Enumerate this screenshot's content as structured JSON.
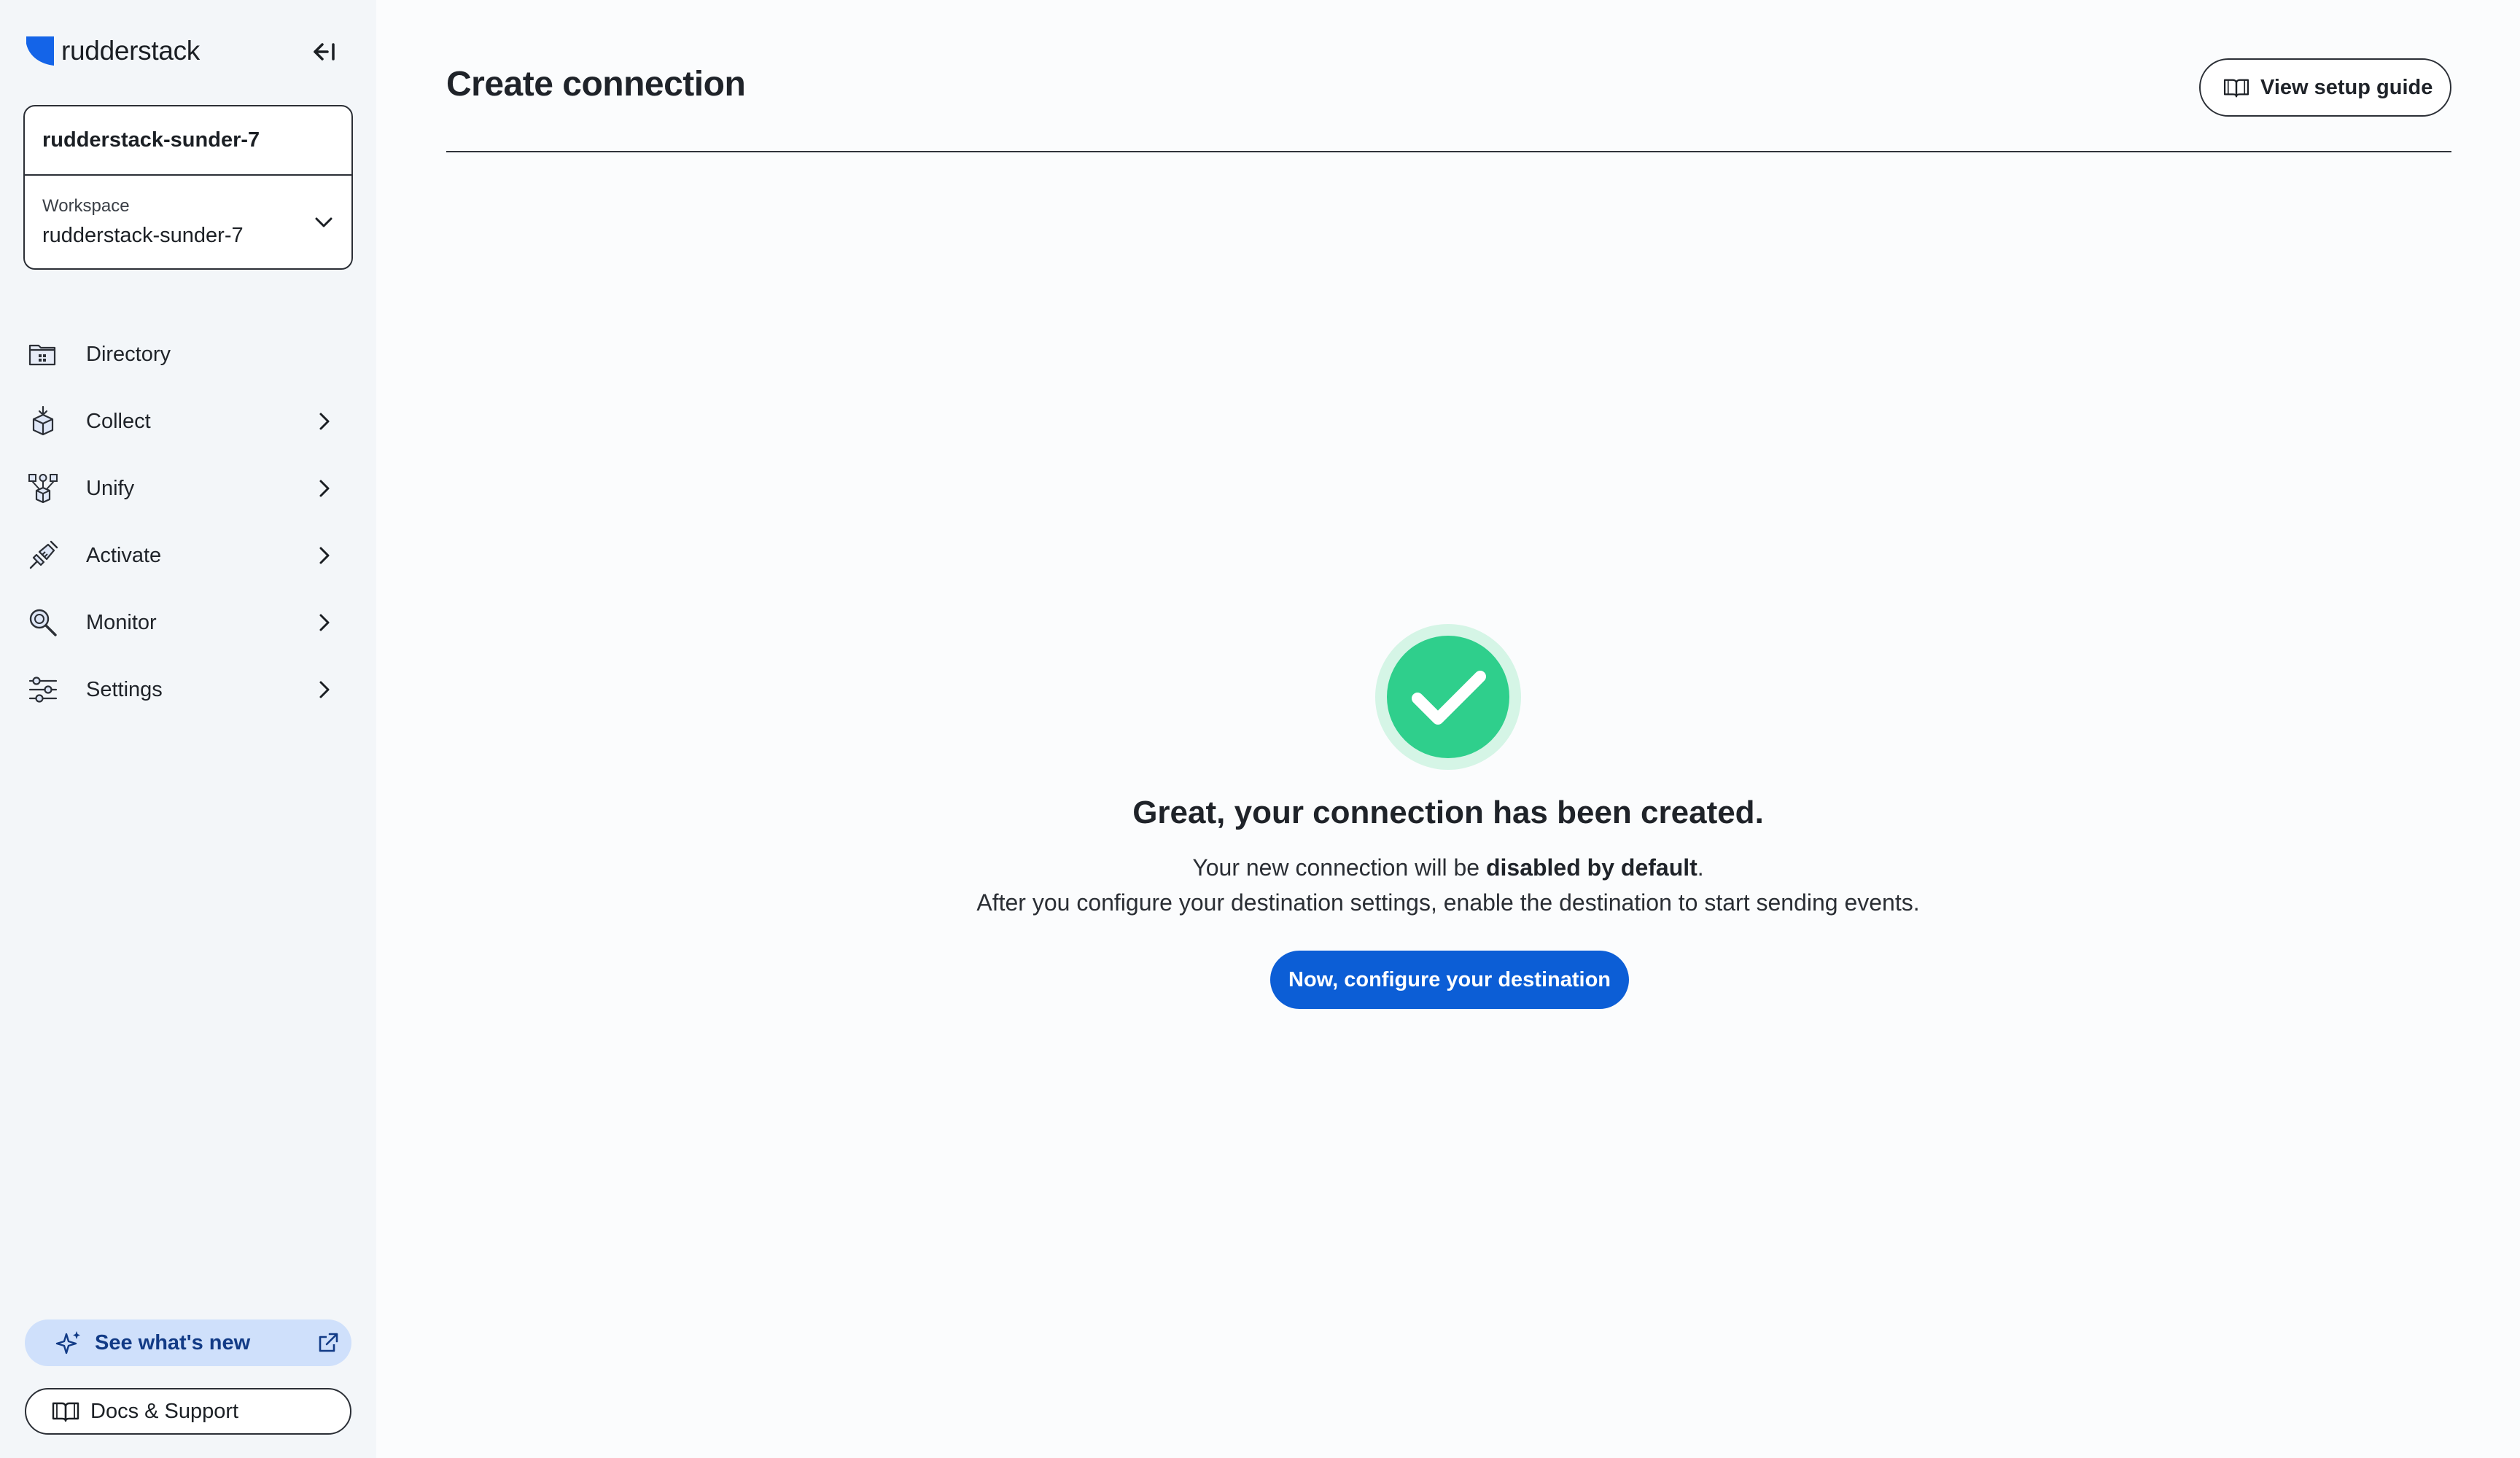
{
  "brand": {
    "name": "rudderstack"
  },
  "workspace": {
    "organization": "rudderstack-sunder-7",
    "label": "Workspace",
    "value": "rudderstack-sunder-7"
  },
  "nav": {
    "items": [
      {
        "label": "Directory",
        "icon": "directory-icon"
      },
      {
        "label": "Collect",
        "icon": "collect-icon"
      },
      {
        "label": "Unify",
        "icon": "unify-icon"
      },
      {
        "label": "Activate",
        "icon": "activate-icon"
      },
      {
        "label": "Monitor",
        "icon": "monitor-icon"
      },
      {
        "label": "Settings",
        "icon": "settings-icon"
      }
    ]
  },
  "sidebar_footer": {
    "whats_new_label": "See what's new",
    "docs_label": "Docs & Support"
  },
  "header": {
    "title": "Create connection",
    "guide_button_label": "View setup guide"
  },
  "success": {
    "headline": "Great, your connection has been created.",
    "line1_prefix": "Your new connection will be ",
    "line1_bold": "disabled by default",
    "line1_suffix": ".",
    "line2": "After you configure your destination settings, enable the destination to start sending events.",
    "cta_label": "Now, configure your destination"
  },
  "colors": {
    "accent": "#0c5ed6",
    "success": "#2fcf8c",
    "success_ring": "#d5f5e6",
    "whats_new_bg": "#cfe0fb",
    "sidebar_bg": "#f3f6f9"
  }
}
